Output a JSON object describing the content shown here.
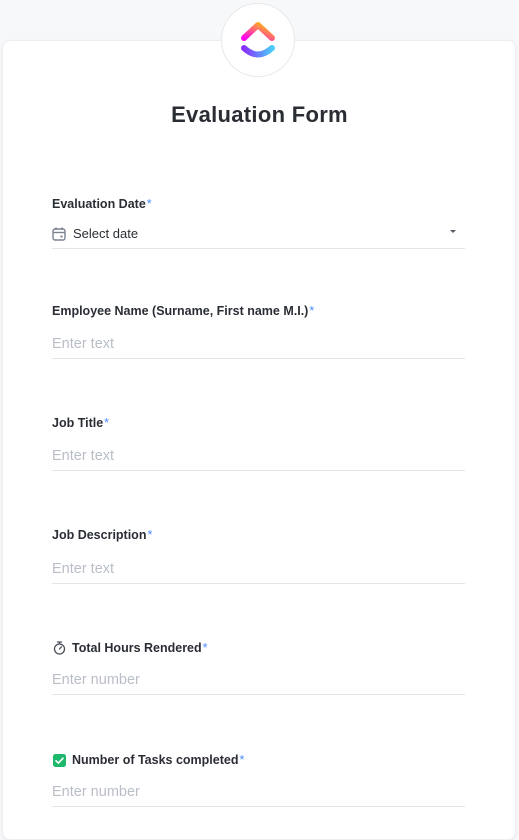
{
  "form": {
    "title": "Evaluation Form",
    "required_marker": "*",
    "accent_color": "#4f8cff"
  },
  "fields": [
    {
      "label": "Evaluation Date",
      "icon": "calendar-icon",
      "value": "Select date"
    },
    {
      "label": "Employee Name (Surname, First name M.I.)",
      "placeholder": "Enter text"
    },
    {
      "label": "Job Title",
      "placeholder": "Enter text"
    },
    {
      "label": "Job Description",
      "placeholder": "Enter text"
    },
    {
      "label": "Total Hours Rendered",
      "label_icon": "stopwatch-icon",
      "placeholder": "Enter number"
    },
    {
      "label": "Number of Tasks completed",
      "label_icon": "green-checkbox-icon",
      "placeholder": "Enter number"
    }
  ]
}
